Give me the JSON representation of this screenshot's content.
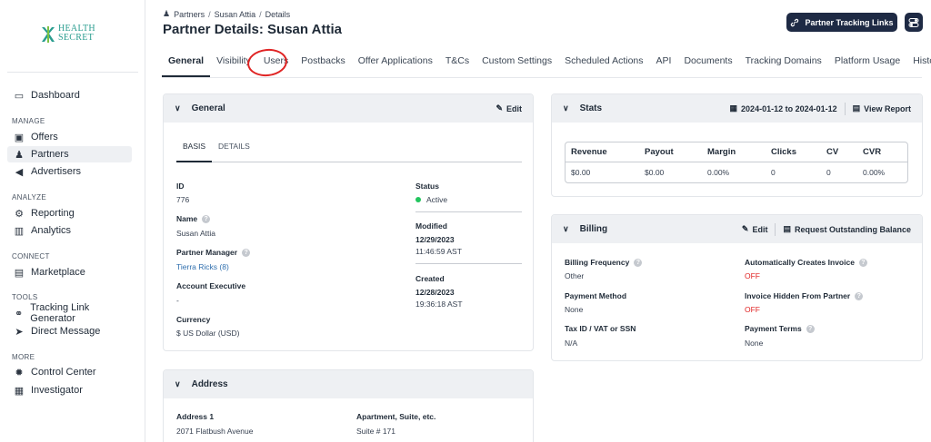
{
  "brand": {
    "logo_line1": "HEALTH",
    "logo_line2": "SECRET",
    "accent": "#2a9d8f"
  },
  "sidebar": {
    "items": [
      {
        "label": "Dashboard",
        "icon": "monitor-icon"
      },
      {
        "label": "Offers",
        "icon": "offers-icon"
      },
      {
        "label": "Partners",
        "icon": "partners-icon"
      },
      {
        "label": "Advertisers",
        "icon": "megaphone-icon"
      },
      {
        "label": "Reporting",
        "icon": "reporting-icon"
      },
      {
        "label": "Analytics",
        "icon": "analytics-icon"
      },
      {
        "label": "Marketplace",
        "icon": "marketplace-icon"
      },
      {
        "label": "Tracking Link Generator",
        "icon": "link-icon"
      },
      {
        "label": "Direct Message",
        "icon": "send-icon"
      },
      {
        "label": "Control Center",
        "icon": "gear-icon"
      },
      {
        "label": "Investigator",
        "icon": "investigator-icon"
      }
    ],
    "sections": {
      "manage": "MANAGE",
      "analyze": "ANALYZE",
      "connect": "CONNECT",
      "tools": "TOOLS",
      "more": "MORE"
    },
    "active": "Partners"
  },
  "header": {
    "breadcrumb": [
      "Partners",
      "Susan Attia",
      "Details"
    ],
    "breadcrumb_sep": "/",
    "title": "Partner Details: Susan Attia",
    "primary_button": "Partner Tracking Links"
  },
  "tabs": [
    "General",
    "Visibility",
    "Users",
    "Postbacks",
    "Offer Applications",
    "T&Cs",
    "Custom Settings",
    "Scheduled Actions",
    "API",
    "Documents",
    "Tracking Domains",
    "Platform Usage",
    "History"
  ],
  "general": {
    "title": "General",
    "edit": "Edit",
    "subtabs": [
      "BASIS",
      "DETAILS"
    ],
    "id_label": "ID",
    "id": "776",
    "name_label": "Name",
    "name": "Susan Attia",
    "manager_label": "Partner Manager",
    "manager": "Tierra Ricks (8)",
    "exec_label": "Account Executive",
    "exec": "-",
    "currency_label": "Currency",
    "currency": "$ US Dollar (USD)",
    "status_label": "Status",
    "status": "Active",
    "modified_label": "Modified",
    "modified_date": "12/29/2023",
    "modified_time": "11:46:59 AST",
    "created_label": "Created",
    "created_date": "12/28/2023",
    "created_time": "19:36:18 AST"
  },
  "stats": {
    "title": "Stats",
    "date_range": "2024-01-12 to 2024-01-12",
    "view_report": "View Report",
    "columns": [
      "Revenue",
      "Payout",
      "Margin",
      "Clicks",
      "CV",
      "CVR"
    ],
    "values": [
      "$0.00",
      "$0.00",
      "0.00%",
      "0",
      "0",
      "0.00%"
    ]
  },
  "billing": {
    "title": "Billing",
    "edit": "Edit",
    "request": "Request Outstanding Balance",
    "frequency_label": "Billing Frequency",
    "frequency": "Other",
    "payment_label": "Payment Method",
    "payment": "None",
    "tax_label": "Tax ID / VAT or SSN",
    "tax": "N/A",
    "auto_invoice_label": "Automatically Creates Invoice",
    "auto_invoice": "OFF",
    "hidden_label": "Invoice Hidden From Partner",
    "hidden": "OFF",
    "terms_label": "Payment Terms",
    "terms": "None"
  },
  "address": {
    "title": "Address",
    "address1_label": "Address 1",
    "address1": "2071 Flatbush Avenue",
    "apt_label": "Apartment, Suite, etc.",
    "apt": "Suite # 171"
  }
}
